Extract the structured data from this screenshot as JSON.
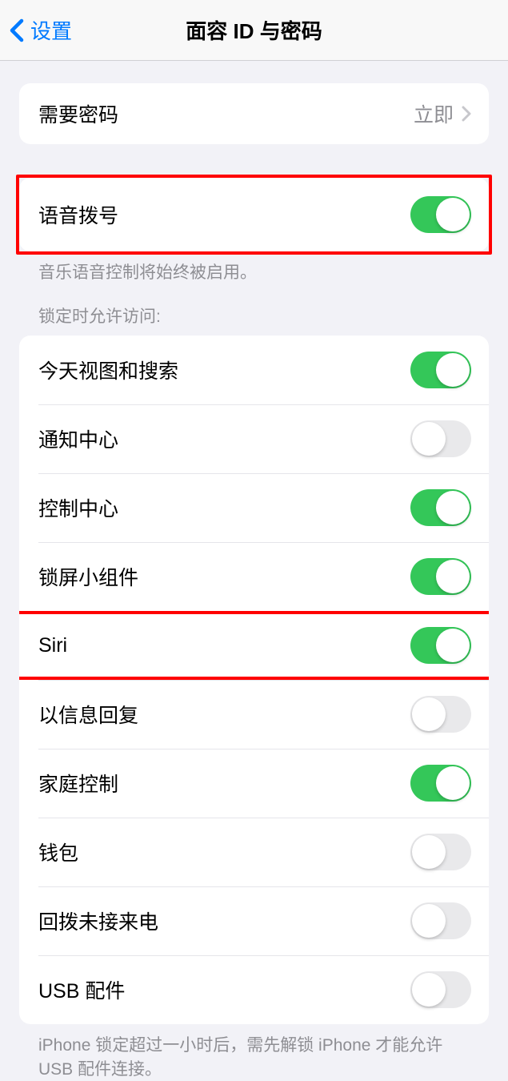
{
  "nav": {
    "back_label": "设置",
    "title": "面容 ID 与密码"
  },
  "passcode_group": {
    "require_passcode": {
      "label": "需要密码",
      "value": "立即"
    }
  },
  "voice_dial": {
    "label": "语音拨号",
    "on": true,
    "footer": "音乐语音控制将始终被启用。"
  },
  "lock_access": {
    "header": "锁定时允许访问:",
    "items": [
      {
        "label": "今天视图和搜索",
        "on": true
      },
      {
        "label": "通知中心",
        "on": false
      },
      {
        "label": "控制中心",
        "on": true
      },
      {
        "label": "锁屏小组件",
        "on": true
      },
      {
        "label": "Siri",
        "on": true
      },
      {
        "label": "以信息回复",
        "on": false
      },
      {
        "label": "家庭控制",
        "on": true
      },
      {
        "label": "钱包",
        "on": false
      },
      {
        "label": "回拨未接来电",
        "on": false
      },
      {
        "label": "USB 配件",
        "on": false
      }
    ],
    "footer": "iPhone 锁定超过一小时后，需先解锁 iPhone 才能允许 USB 配件连接。"
  }
}
